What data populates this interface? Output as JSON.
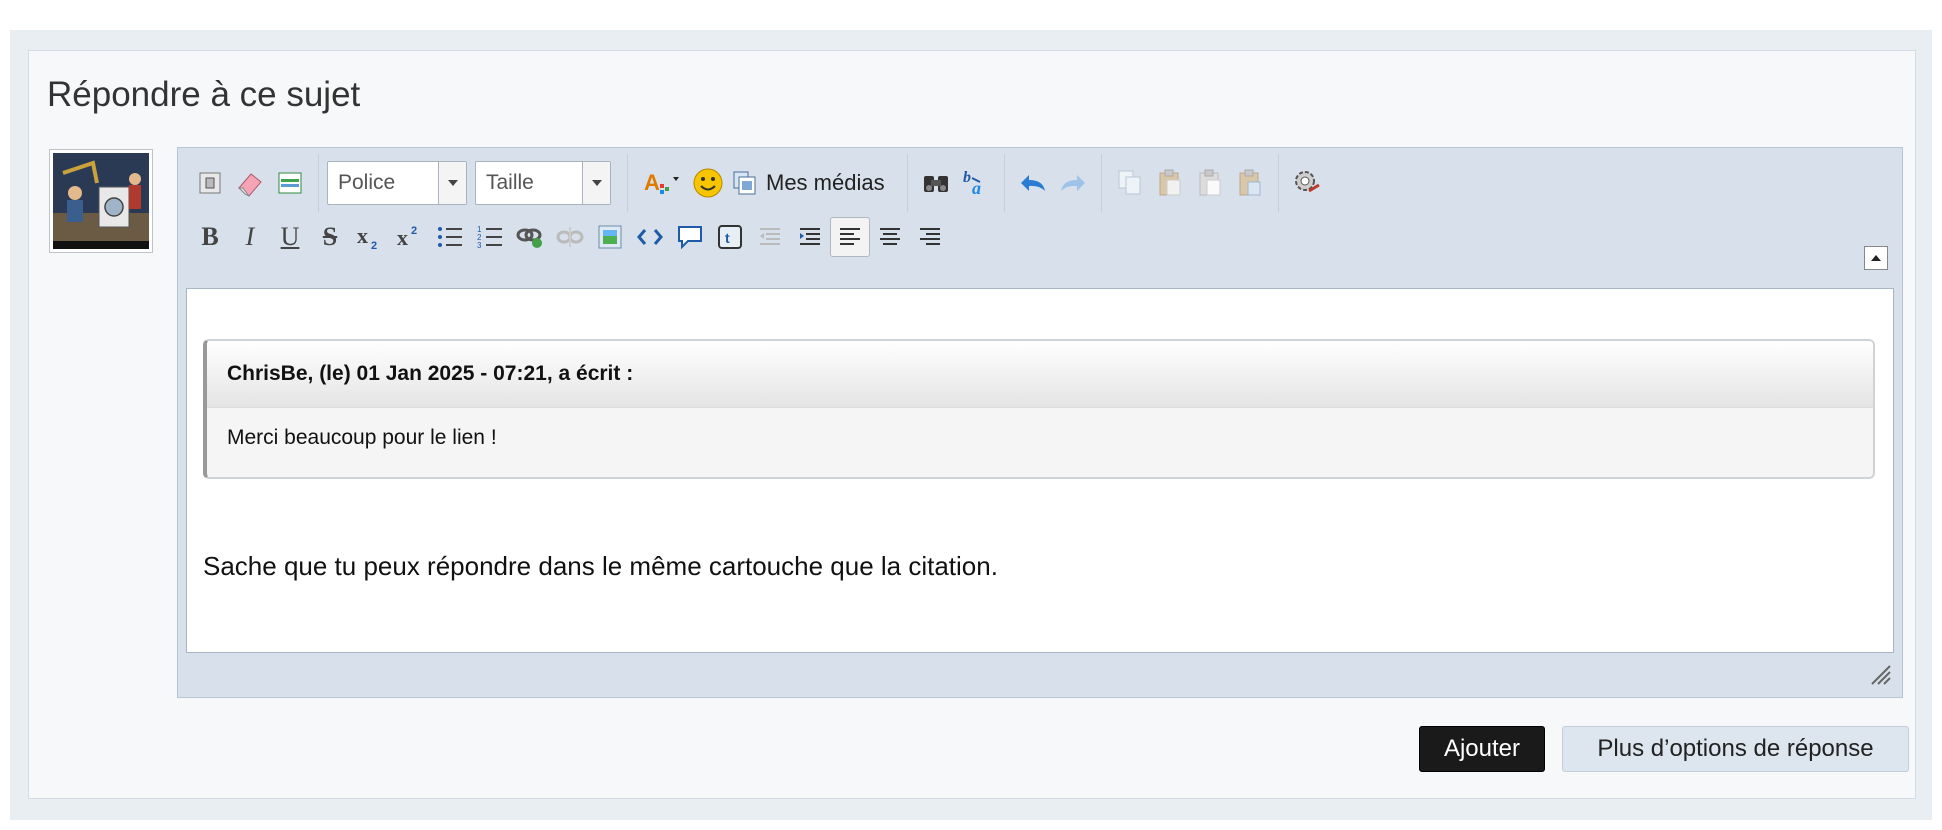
{
  "reply": {
    "title": "Répondre à ce sujet"
  },
  "toolbar": {
    "font_select": "Police",
    "size_select": "Taille",
    "media_label": "Mes médias"
  },
  "editor": {
    "quote": {
      "header": "ChrisBe, (le) 01 Jan 2025 - 07:21, a écrit :",
      "body": "Merci beaucoup pour le lien !"
    },
    "reply_text": "Sache que tu peux répondre dans le même cartouche que la citation."
  },
  "buttons": {
    "add": "Ajouter",
    "more_options": "Plus d’options de réponse"
  },
  "colors": {
    "accent_dark": "#1a1a1a",
    "panel_bg": "#e9eef3",
    "editor_bg": "#d8e1eb"
  }
}
